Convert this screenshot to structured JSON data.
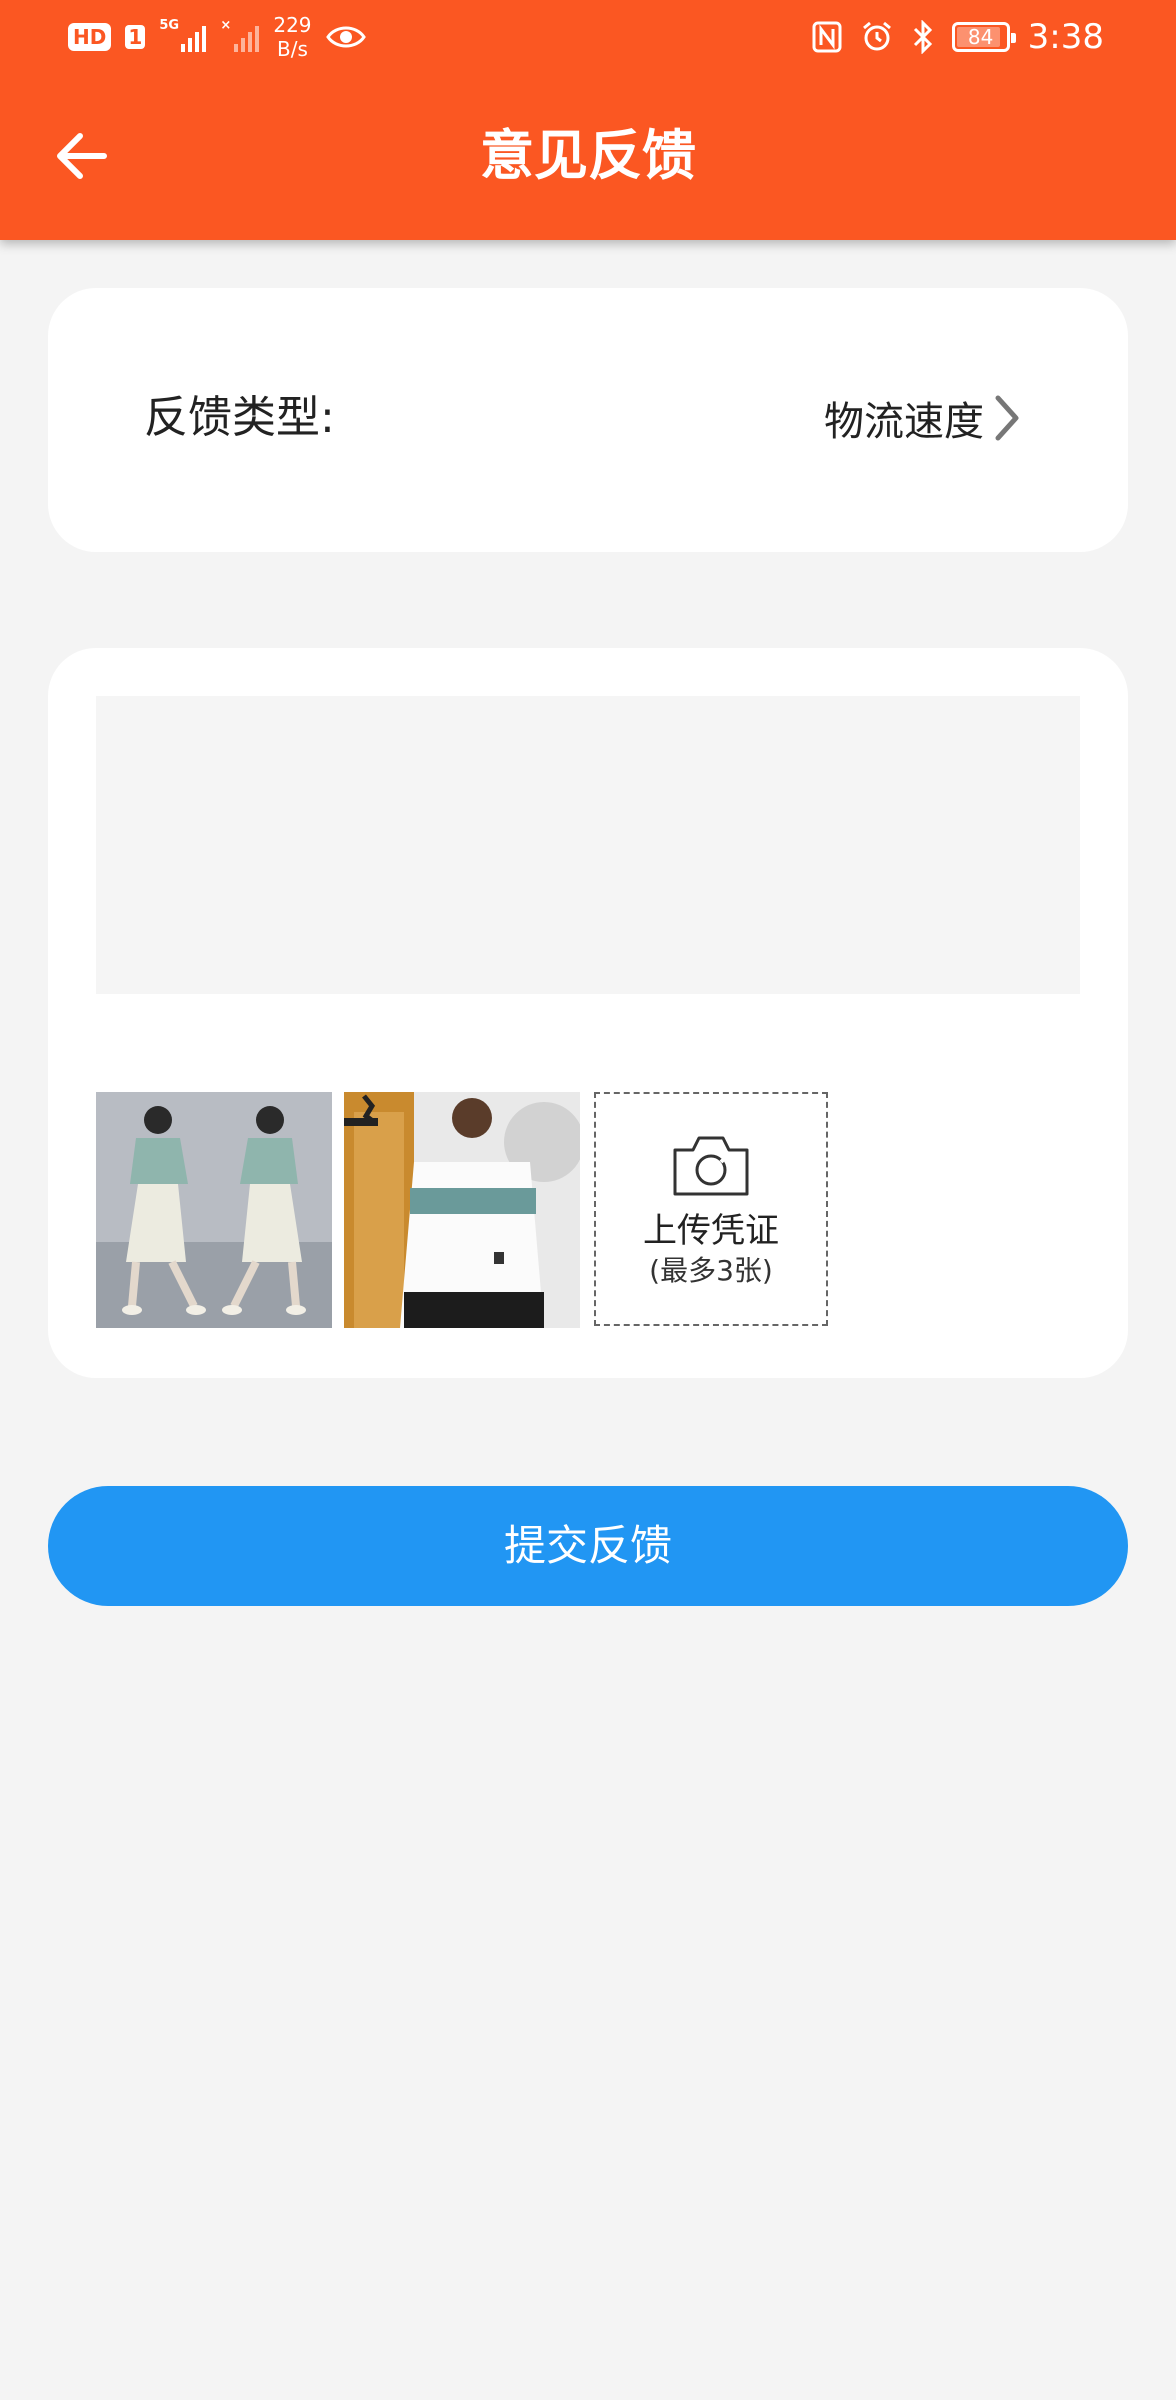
{
  "status_bar": {
    "hd_badge": "HD",
    "sim_badge": "1",
    "signal1_tag": "5G",
    "signal2_tag": "×",
    "net_speed_value": "229",
    "net_speed_unit": "B/s",
    "battery_level": "84",
    "time": "3:38"
  },
  "header": {
    "title": "意见反馈",
    "back_icon": "arrow-left-icon"
  },
  "feedback_type": {
    "label": "反馈类型:",
    "value": "物流速度",
    "chevron_icon": "chevron-right-icon"
  },
  "content": {
    "textarea_value": "",
    "textarea_placeholder": ""
  },
  "attachments": {
    "items": [
      {
        "description": "woman-outfit-photo"
      },
      {
        "description": "man-sweatshirt-photo"
      }
    ],
    "upload_label": "上传凭证",
    "upload_hint": "(最多3张)",
    "upload_icon": "camera-icon"
  },
  "submit": {
    "label": "提交反馈"
  },
  "colors": {
    "header_bg": "#fb5722",
    "page_bg": "#f4f4f4",
    "submit_bg": "#2196f3"
  }
}
